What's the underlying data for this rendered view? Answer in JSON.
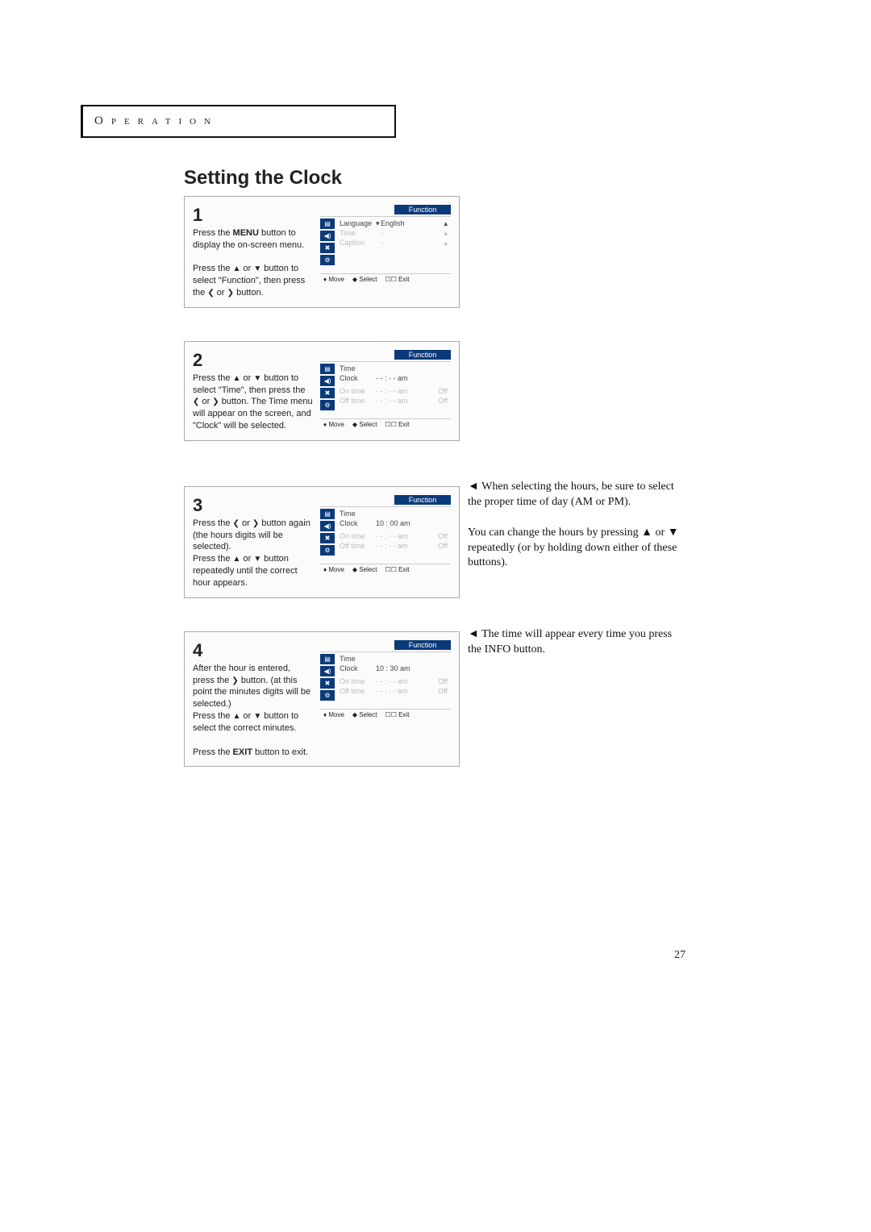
{
  "pageNumber": "27",
  "headerLabel": "Operation",
  "title": "Setting the Clock",
  "osdTitle": "Function",
  "osdFooter": {
    "move": "Move",
    "select": "Select",
    "exit": "Exit"
  },
  "glyphs": {
    "up": "▲",
    "down": "▼",
    "left": "❮",
    "right": "❯",
    "updown": "♦",
    "leftright": "◆",
    "boxExit": "☐☐",
    "noteArrow": "◄"
  },
  "steps": {
    "1": {
      "num": "1",
      "para1a": "Press the ",
      "para1bold": "MENU",
      "para1b": " button to display the on-screen menu.",
      "para2a": "Press the ",
      "para2b": " or ",
      "para2c": " button to select \"Function\", then press the ",
      "para2d": "  or  ",
      "para2e": "  button.",
      "osd": {
        "r1": {
          "k": "Language",
          "v": "English"
        },
        "r2": {
          "k": "Time",
          "v": "-"
        },
        "r3": {
          "k": "Caption",
          "v": "-"
        }
      }
    },
    "2": {
      "num": "2",
      "para1a": "Press the ",
      "para1b": " or ",
      "para1c": " button to select \"Time\", then press the ",
      "para1d": "  or  ",
      "para1e": "  button. The Time menu will appear on the screen, and \"Clock\" will be selected.",
      "osd": {
        "r1": {
          "k": "Time",
          "v": "",
          "s": ""
        },
        "r2": {
          "k": "Clock",
          "v": "- -  :  - - am",
          "s": ""
        },
        "r3": {
          "k": "On time",
          "v": "- -  :  - - am",
          "s": "Off"
        },
        "r4": {
          "k": "Off time",
          "v": "- -  :  - - am",
          "s": "Off"
        }
      }
    },
    "3": {
      "num": "3",
      "para1a": "Press the ",
      "para1b": "  or  ",
      "para1c": "  button again (the hours digits will be selected).",
      "para2a": "Press the ",
      "para2b": " or  ",
      "para2c": " button repeatedly until the correct hour appears.",
      "osd": {
        "r1": {
          "k": "Time",
          "v": "",
          "s": ""
        },
        "r2": {
          "k": "Clock",
          "v": "10 : 00 am",
          "s": ""
        },
        "r3": {
          "k": "On time",
          "v": "- -  :  - - am",
          "s": "Off"
        },
        "r4": {
          "k": "Off time",
          "v": "- -  :  - - am",
          "s": "Off"
        }
      }
    },
    "4": {
      "num": "4",
      "para1a": "After the hour is entered, press the ",
      "para1b": "  button. (at this point the minutes digits will be selected.)",
      "para2a": "Press the ",
      "para2b": " or ",
      "para2c": " button to select the correct minutes.",
      "para3a": "Press the ",
      "para3bold": "EXIT",
      "para3b": " button to exit.",
      "osd": {
        "r1": {
          "k": "Time",
          "v": "",
          "s": ""
        },
        "r2": {
          "k": "Clock",
          "v": "10 : 30 am",
          "s": ""
        },
        "r3": {
          "k": "On time",
          "v": "- -  :  - - am",
          "s": "Off"
        },
        "r4": {
          "k": "Off time",
          "v": "- -  :  - - am",
          "s": "Off"
        }
      }
    }
  },
  "notes": {
    "n1a": "When selecting the hours, be sure to select the proper time of day (AM or PM).",
    "n1b_a": "You can change the hours by pressing ",
    "n1b_b": " or ",
    "n1b_c": " repeatedly (or by holding down either of these buttons).",
    "n2": "The time will appear every time you press the INFO button."
  }
}
